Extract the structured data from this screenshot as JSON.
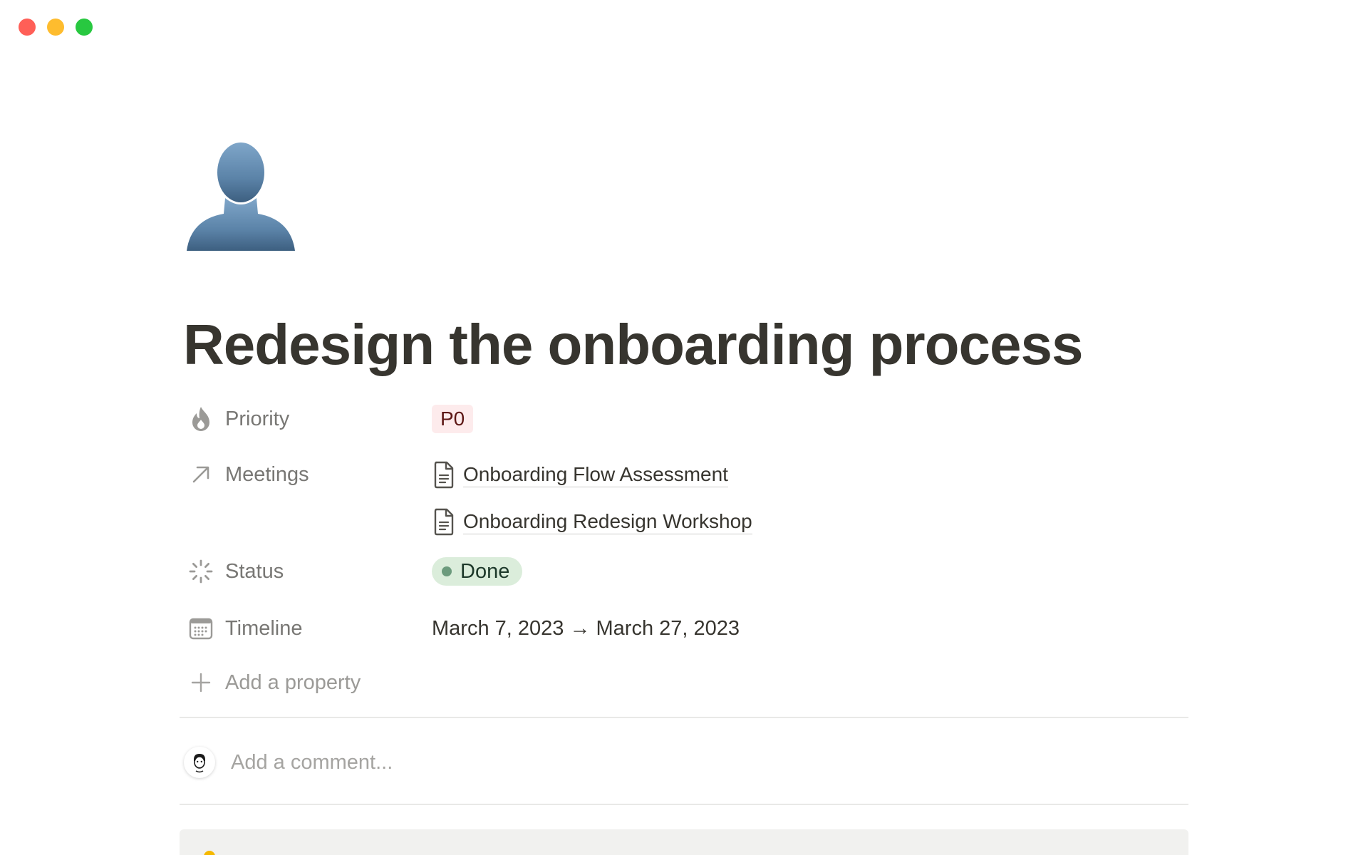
{
  "window": {
    "controls": [
      "close",
      "minimize",
      "zoom"
    ]
  },
  "page": {
    "icon": "bust-in-silhouette-icon",
    "title": "Redesign the onboarding process"
  },
  "properties": {
    "priority": {
      "name": "Priority",
      "icon": "fire-icon",
      "value": "P0",
      "color": "#fdebec"
    },
    "meetings": {
      "name": "Meetings",
      "icon": "arrow-up-right-icon",
      "items": [
        {
          "label": "Onboarding Flow Assessment",
          "icon": "document-icon"
        },
        {
          "label": "Onboarding Redesign Workshop",
          "icon": "document-icon"
        }
      ]
    },
    "status": {
      "name": "Status",
      "icon": "status-spinner-icon",
      "value": "Done",
      "color": "#dbeddb",
      "dot_color": "#6c9b7d"
    },
    "timeline": {
      "name": "Timeline",
      "icon": "calendar-icon",
      "value": "March 7, 2023 → March 27, 2023"
    },
    "add_property": {
      "label": "Add a property",
      "icon": "plus-icon"
    }
  },
  "comments": {
    "placeholder": "Add a comment...",
    "avatar": "user-avatar"
  },
  "colors": {
    "text": "#37352f",
    "muted": "#787774",
    "divider": "#e9e9e7",
    "callout_bg": "#f1f1ef"
  }
}
